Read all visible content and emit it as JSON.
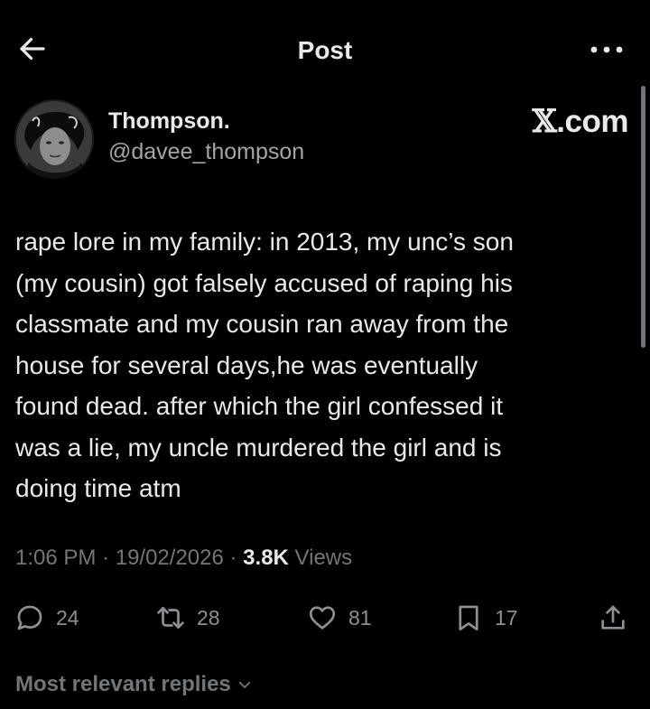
{
  "header": {
    "title": "Post",
    "back_icon": "arrow-left-icon",
    "more_icon": "more-horizontal-icon"
  },
  "author": {
    "display_name": "Thompson.",
    "handle": "@davee_thompson",
    "avatar_icon": "avatar-photo"
  },
  "watermark": {
    "x_logo": "𝕏",
    "domain_suffix": ".com"
  },
  "tweet": {
    "text_lines": [
      "rape lore in my family: in 2013, my unc’s son",
      "(my cousin) got falsely accused of raping his",
      "classmate and my cousin ran away from the",
      "house for several days,he was eventually",
      "found dead. after which the girl confessed it",
      "was a lie, my uncle murdered the girl and is",
      "doing time atm"
    ]
  },
  "meta": {
    "time": "1:06 PM",
    "separator": " · ",
    "date": "19/02/2026",
    "views_count": "3.8K",
    "views_label": " Views"
  },
  "actions": {
    "replies": "24",
    "reposts": "28",
    "likes": "81",
    "bookmarks": "17",
    "icons": [
      "reply-icon",
      "repost-icon",
      "like-icon",
      "bookmark-icon",
      "share-icon"
    ]
  },
  "replies_sort": {
    "label": "Most relevant replies"
  },
  "colors": {
    "background": "#000000",
    "text": "#e7e9ea",
    "muted": "#71767b"
  }
}
